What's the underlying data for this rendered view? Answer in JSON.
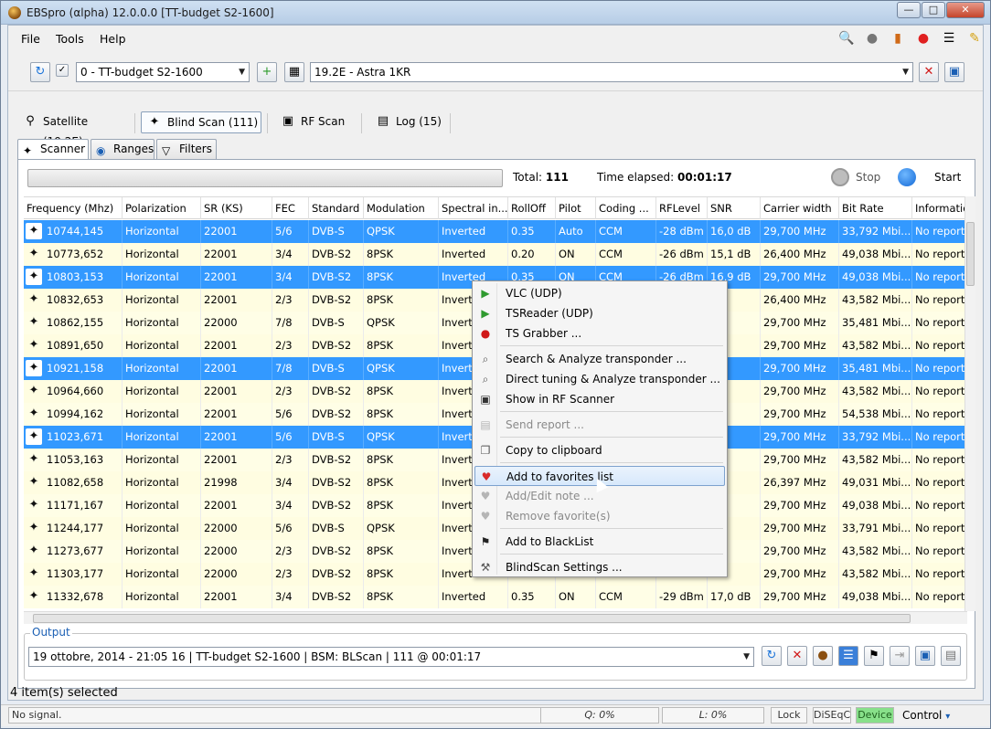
{
  "window": {
    "title": "EBSpro (αlpha) 12.0.0.0 [TT-budget S2-1600]"
  },
  "menu": {
    "file": "File",
    "tools": "Tools",
    "help": "Help"
  },
  "toolbar": {
    "tuner": "0 - TT-budget S2-1600",
    "satellite": "19.2E - Astra 1KR"
  },
  "modes": [
    {
      "label": "Satellite (19.2E)"
    },
    {
      "label": "Blind Scan (111)"
    },
    {
      "label": "RF Scan"
    },
    {
      "label": "Log (15)"
    }
  ],
  "subtabs": [
    {
      "label": "Scanner"
    },
    {
      "label": "Ranges"
    },
    {
      "label": "Filters"
    }
  ],
  "scanner": {
    "total_label": "Total:",
    "total_value": "111",
    "elapsed_label": "Time elapsed:",
    "elapsed_value": "00:01:17",
    "stop": "Stop",
    "start": "Start"
  },
  "columns": [
    "Frequency (Mhz)",
    "Polarization",
    "SR (KS)",
    "FEC",
    "Standard",
    "Modulation",
    "Spectral in...",
    "RollOff",
    "Pilot",
    "Coding ...",
    "RFLevel",
    "SNR",
    "Carrier width",
    "Bit Rate",
    "Informatio"
  ],
  "rows": [
    {
      "sel": true,
      "c": [
        "10744,145",
        "Horizontal",
        "22001",
        "5/6",
        "DVB-S",
        "QPSK",
        "Inverted",
        "0.35",
        "Auto",
        "CCM",
        "-28 dBm",
        "16,0 dB",
        "29,700 MHz",
        "33,792 Mbi...",
        "No report"
      ]
    },
    {
      "sel": false,
      "c": [
        "10773,652",
        "Horizontal",
        "22001",
        "3/4",
        "DVB-S2",
        "8PSK",
        "Inverted",
        "0.20",
        "ON",
        "CCM",
        "-26 dBm",
        "15,1 dB",
        "26,400 MHz",
        "49,038 Mbi...",
        "No report"
      ]
    },
    {
      "sel": true,
      "c": [
        "10803,153",
        "Horizontal",
        "22001",
        "3/4",
        "DVB-S2",
        "8PSK",
        "Inverted",
        "0.35",
        "ON",
        "CCM",
        "-26 dBm",
        "16,9 dB",
        "29,700 MHz",
        "49,038 Mbi...",
        "No report"
      ]
    },
    {
      "sel": false,
      "c": [
        "10832,653",
        "Horizontal",
        "22001",
        "2/3",
        "DVB-S2",
        "8PSK",
        "Inverted",
        "",
        "",
        "",
        "",
        "dB",
        "26,400 MHz",
        "43,582 Mbi...",
        "No report"
      ]
    },
    {
      "sel": false,
      "c": [
        "10862,155",
        "Horizontal",
        "22000",
        "7/8",
        "DVB-S",
        "QPSK",
        "Inverted",
        "",
        "",
        "",
        "",
        "dB",
        "29,700 MHz",
        "35,481 Mbi...",
        "No report"
      ]
    },
    {
      "sel": false,
      "c": [
        "10891,650",
        "Horizontal",
        "22001",
        "2/3",
        "DVB-S2",
        "8PSK",
        "Inverted",
        "",
        "",
        "",
        "",
        "dB",
        "29,700 MHz",
        "43,582 Mbi...",
        "No report"
      ]
    },
    {
      "sel": true,
      "c": [
        "10921,158",
        "Horizontal",
        "22001",
        "7/8",
        "DVB-S",
        "QPSK",
        "Inverted",
        "",
        "",
        "",
        "",
        "dB",
        "29,700 MHz",
        "35,481 Mbi...",
        "No report"
      ]
    },
    {
      "sel": false,
      "c": [
        "10964,660",
        "Horizontal",
        "22001",
        "2/3",
        "DVB-S2",
        "8PSK",
        "Inverted",
        "",
        "",
        "",
        "",
        "dB",
        "29,700 MHz",
        "43,582 Mbi...",
        "No report"
      ]
    },
    {
      "sel": false,
      "c": [
        "10994,162",
        "Horizontal",
        "22001",
        "5/6",
        "DVB-S2",
        "8PSK",
        "Inverted",
        "",
        "",
        "",
        "",
        "dB",
        "29,700 MHz",
        "54,538 Mbi...",
        "No report"
      ]
    },
    {
      "sel": true,
      "c": [
        "11023,671",
        "Horizontal",
        "22001",
        "5/6",
        "DVB-S",
        "QPSK",
        "Inverted",
        "",
        "",
        "",
        "",
        "dB",
        "29,700 MHz",
        "33,792 Mbi...",
        "No report"
      ]
    },
    {
      "sel": false,
      "c": [
        "11053,163",
        "Horizontal",
        "22001",
        "2/3",
        "DVB-S2",
        "8PSK",
        "Inverted",
        "",
        "",
        "",
        "",
        "dB",
        "29,700 MHz",
        "43,582 Mbi...",
        "No report"
      ]
    },
    {
      "sel": false,
      "c": [
        "11082,658",
        "Horizontal",
        "21998",
        "3/4",
        "DVB-S2",
        "8PSK",
        "Inverted",
        "",
        "",
        "",
        "",
        "dB",
        "26,397 MHz",
        "49,031 Mbi...",
        "No report"
      ]
    },
    {
      "sel": false,
      "c": [
        "11171,167",
        "Horizontal",
        "22001",
        "3/4",
        "DVB-S2",
        "8PSK",
        "Inverted",
        "",
        "",
        "",
        "",
        "dB",
        "29,700 MHz",
        "49,038 Mbi...",
        "No report"
      ]
    },
    {
      "sel": false,
      "c": [
        "11244,177",
        "Horizontal",
        "22000",
        "5/6",
        "DVB-S",
        "QPSK",
        "Inverted",
        "",
        "",
        "",
        "",
        "dB",
        "29,700 MHz",
        "33,791 Mbi...",
        "No report"
      ]
    },
    {
      "sel": false,
      "c": [
        "11273,677",
        "Horizontal",
        "22000",
        "2/3",
        "DVB-S2",
        "8PSK",
        "Inverted",
        "",
        "",
        "",
        "",
        "dB",
        "29,700 MHz",
        "43,582 Mbi...",
        "No report"
      ]
    },
    {
      "sel": false,
      "c": [
        "11303,177",
        "Horizontal",
        "22000",
        "2/3",
        "DVB-S2",
        "8PSK",
        "Inverted",
        "",
        "",
        "",
        "",
        "dB",
        "29,700 MHz",
        "43,582 Mbi...",
        "No report"
      ]
    },
    {
      "sel": false,
      "c": [
        "11332,678",
        "Horizontal",
        "22001",
        "3/4",
        "DVB-S2",
        "8PSK",
        "Inverted",
        "0.35",
        "ON",
        "CCM",
        "-29 dBm",
        "17,0 dB",
        "29,700 MHz",
        "49,038 Mbi...",
        "No report"
      ]
    }
  ],
  "context_menu": [
    {
      "label": "VLC (UDP)",
      "icon": "play-icon",
      "disabled": false
    },
    {
      "label": "TSReader (UDP)",
      "icon": "play-icon",
      "disabled": false
    },
    {
      "label": "TS Grabber ...",
      "icon": "record-icon",
      "disabled": false
    },
    {
      "sep": true
    },
    {
      "label": "Search & Analyze transponder ...",
      "icon": "search-icon",
      "disabled": false
    },
    {
      "label": "Direct tuning & Analyze transponder ...",
      "icon": "search-icon",
      "disabled": false
    },
    {
      "label": "Show in RF Scanner",
      "icon": "monitor-icon",
      "disabled": false
    },
    {
      "sep": true
    },
    {
      "label": "Send report ...",
      "icon": "report-icon",
      "disabled": true
    },
    {
      "sep": true
    },
    {
      "label": "Copy to clipboard",
      "icon": "copy-icon",
      "disabled": false
    },
    {
      "sep": true
    },
    {
      "label": "Add to favorites list",
      "icon": "heart-icon",
      "disabled": false,
      "hover": true
    },
    {
      "label": "Add/Edit note ...",
      "icon": "note-icon",
      "disabled": true
    },
    {
      "label": "Remove favorite(s)",
      "icon": "remove-icon",
      "disabled": true
    },
    {
      "sep": true
    },
    {
      "label": "Add to BlackList",
      "icon": "flag-icon",
      "disabled": false
    },
    {
      "sep": true
    },
    {
      "label": "BlindScan Settings ...",
      "icon": "settings-icon",
      "disabled": false
    }
  ],
  "output": {
    "legend": "Output",
    "text": "19 ottobre, 2014 - 21:05 16 | TT-budget S2-1600 | BSM: BLScan | 111 @ 00:01:17"
  },
  "selection": "4 item(s) selected",
  "status": {
    "signal": "No signal.",
    "q": "Q: 0%",
    "l": "L: 0%",
    "lock": "Lock",
    "diseqc": "DiSEqC",
    "device": "Device",
    "control": "Control"
  },
  "colors": {
    "selected": "#3399ff",
    "row_bg": "#fffee6",
    "accent": "#1a5fb4"
  }
}
